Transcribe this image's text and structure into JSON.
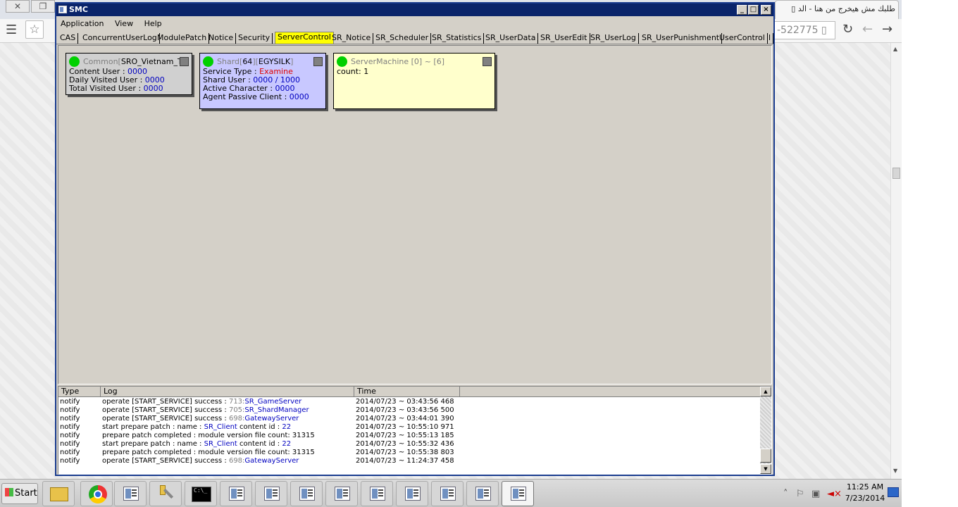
{
  "browser": {
    "tab_title": "طلبك مش هيخرج من هنا - الد",
    "omnibox_fragment": "-522775",
    "menu_icon": "menu-icon",
    "star_icon": "star-icon",
    "nav_icons": [
      "refresh-icon",
      "back-icon",
      "forward-icon"
    ]
  },
  "window": {
    "title": "SMC",
    "buttons": {
      "minimize": "_",
      "maximize": "□",
      "close": "×"
    }
  },
  "menu": [
    "Application",
    "View",
    "Help"
  ],
  "tabs": [
    "CAS",
    "ConcurrentUserLog",
    "ModulePatch",
    "Notice",
    "Security",
    "ServerControl",
    "SR_Notice",
    "SR_Scheduler",
    "SR_Statistics",
    "SR_UserData",
    "SR_UserEdit",
    "SR_UserLog",
    "SR_UserPunishment",
    "UserControl",
    "l"
  ],
  "active_tab": "ServerControl",
  "cards": {
    "common": {
      "head_prefix": "Common[",
      "head_name": "SRO_Vietnam_TestL",
      "rows": [
        {
          "label": "Content User : ",
          "value": "0000"
        },
        {
          "label": "Daily Visited User : ",
          "value": "0000"
        },
        {
          "label": "Total Visited User : ",
          "value": "0000"
        }
      ]
    },
    "shard": {
      "head_prefix": "Shard[",
      "head_id": "64",
      "head_mid": "][",
      "head_name": "EGYSILK",
      "head_suffix": "]",
      "service_label": "Service Type : ",
      "service_value": "Examine",
      "rows": [
        {
          "label": "Shard User : ",
          "value": "0000 / 1000"
        },
        {
          "label": "Active Character : ",
          "value": "0000"
        },
        {
          "label": "Agent Passive Client : ",
          "value": "0000"
        }
      ]
    },
    "machine": {
      "head": "ServerMachine [0] ~ [6]",
      "count": "count: 1"
    }
  },
  "log": {
    "columns": [
      "Type",
      "Log",
      "Time"
    ],
    "rows": [
      {
        "type": "notify",
        "msg": "operate [START_SERVICE] success : ",
        "id": "713:",
        "target": "SR_GameServer",
        "time": "2014/07/23 ~ 03:43:56 468"
      },
      {
        "type": "notify",
        "msg": "operate [START_SERVICE] success : ",
        "id": "705:",
        "target": "SR_ShardManager",
        "time": "2014/07/23 ~ 03:43:56 500"
      },
      {
        "type": "notify",
        "msg": "operate [START_SERVICE] success : ",
        "id": "698:",
        "target": "GatewayServer",
        "time": "2014/07/23 ~ 03:44:01 390"
      },
      {
        "type": "notify",
        "msg": "start prepare patch : name : ",
        "id": "",
        "target": "SR_Client",
        "tail": " content id : ",
        "tail_val": "22",
        "time": "2014/07/23 ~ 10:55:10 971"
      },
      {
        "type": "notify",
        "msg": "prepare patch completed : module version file count: 31315",
        "id": "",
        "target": "",
        "time": "2014/07/23 ~ 10:55:13 185"
      },
      {
        "type": "notify",
        "msg": "start prepare patch : name : ",
        "id": "",
        "target": "SR_Client",
        "tail": " content id : ",
        "tail_val": "22",
        "time": "2014/07/23 ~ 10:55:32 436"
      },
      {
        "type": "notify",
        "msg": "prepare patch completed : module version file count: 31315",
        "id": "",
        "target": "",
        "time": "2014/07/23 ~ 10:55:38 803"
      },
      {
        "type": "notify",
        "msg": "operate [START_SERVICE] success : ",
        "id": "698:",
        "target": "GatewayServer",
        "time": "2014/07/23 ~ 11:24:37 458"
      }
    ]
  },
  "taskbar": {
    "start_label": "Start",
    "clock_time": "11:25 AM",
    "clock_date": "7/23/2014"
  }
}
